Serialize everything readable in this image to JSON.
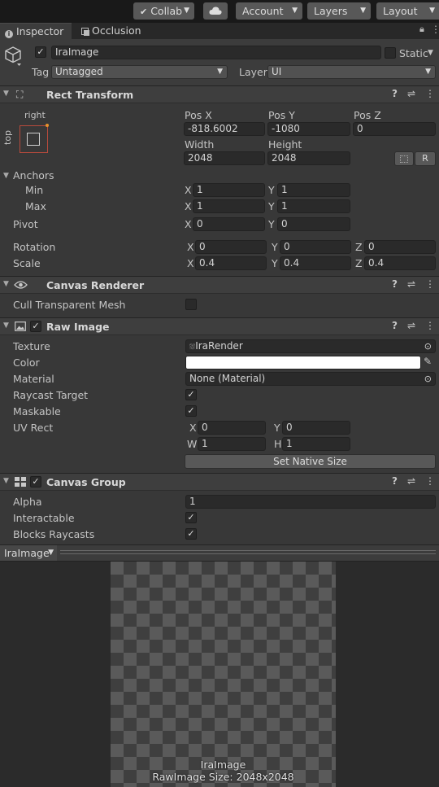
{
  "toolbar": {
    "collab": "Collab",
    "account": "Account",
    "layers": "Layers",
    "layout": "Layout"
  },
  "tabs": {
    "inspector": "Inspector",
    "occlusion": "Occlusion"
  },
  "object": {
    "name": "IraImage",
    "static_label": "Static",
    "tag_label": "Tag",
    "tag_value": "Untagged",
    "layer_label": "Layer",
    "layer_value": "UI"
  },
  "rect_transform": {
    "title": "Rect Transform",
    "anchor_preset_top": "right",
    "anchor_preset_side": "top",
    "pos_x_label": "Pos X",
    "pos_y_label": "Pos Y",
    "pos_z_label": "Pos Z",
    "pos_x": "-818.6002",
    "pos_y": "-1080",
    "pos_z": "0",
    "width_label": "Width",
    "height_label": "Height",
    "width": "2048",
    "height": "2048",
    "r_button": "R",
    "anchors_label": "Anchors",
    "min_label": "Min",
    "max_label": "Max",
    "min_x": "1",
    "min_y": "1",
    "max_x": "1",
    "max_y": "1",
    "pivot_label": "Pivot",
    "pivot_x": "0",
    "pivot_y": "0",
    "rotation_label": "Rotation",
    "rot_x": "0",
    "rot_y": "0",
    "rot_z": "0",
    "scale_label": "Scale",
    "scale_x": "0.4",
    "scale_y": "0.4",
    "scale_z": "0.4",
    "x": "X",
    "y": "Y",
    "z": "Z"
  },
  "canvas_renderer": {
    "title": "Canvas Renderer",
    "cull_label": "Cull Transparent Mesh"
  },
  "raw_image": {
    "title": "Raw Image",
    "texture_label": "Texture",
    "texture_value": "IraRender",
    "color_label": "Color",
    "color_value": "#ffffff",
    "material_label": "Material",
    "material_value": "None (Material)",
    "raycast_label": "Raycast Target",
    "maskable_label": "Maskable",
    "uvrect_label": "UV Rect",
    "uv_x": "0",
    "uv_y": "0",
    "uv_w": "1",
    "uv_h": "1",
    "x": "X",
    "y": "Y",
    "w": "W",
    "h": "H",
    "native_size_button": "Set Native Size"
  },
  "canvas_group": {
    "title": "Canvas Group",
    "alpha_label": "Alpha",
    "alpha_value": "1",
    "interactable_label": "Interactable",
    "blocks_label": "Blocks Raycasts"
  },
  "preview": {
    "dropdown": "IraImage",
    "name": "IraImage",
    "size_text": "RawImage Size: 2048x2048"
  },
  "icons": {
    "check": "✓",
    "help": "?",
    "sliders": "⇌",
    "more": "⋮"
  }
}
